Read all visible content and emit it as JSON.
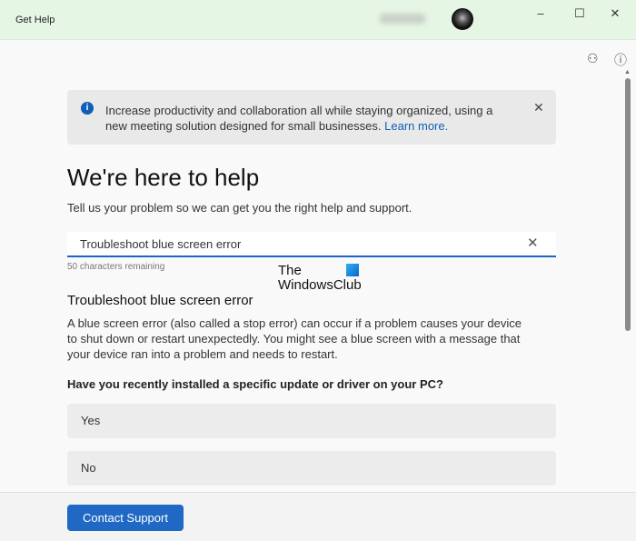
{
  "window": {
    "title": "Get Help"
  },
  "banner": {
    "text": "Increase productivity and collaboration all while staying organized, using a new meeting solution designed for small businesses.",
    "link": "Learn more."
  },
  "header": {
    "title": "We're here to help",
    "subtitle": "Tell us your problem so we can get you the right help and support."
  },
  "search": {
    "value": "Troubleshoot blue screen error",
    "remaining": "50 characters remaining"
  },
  "watermark": {
    "line1": "The",
    "line2": "WindowsClub"
  },
  "result": {
    "title": "Troubleshoot blue screen error",
    "description": "A blue screen error (also called a stop error) can occur if a problem causes your device to shut down or restart unexpectedly. You might see a blue screen with a message that your device ran into a problem and needs to restart.",
    "question": "Have you recently installed a specific update or driver on your PC?",
    "options": [
      "Yes",
      "No"
    ]
  },
  "footer": {
    "contact_label": "Contact Support"
  },
  "colors": {
    "accent": "#1f68c3",
    "titlebar": "#e6f6e4"
  }
}
